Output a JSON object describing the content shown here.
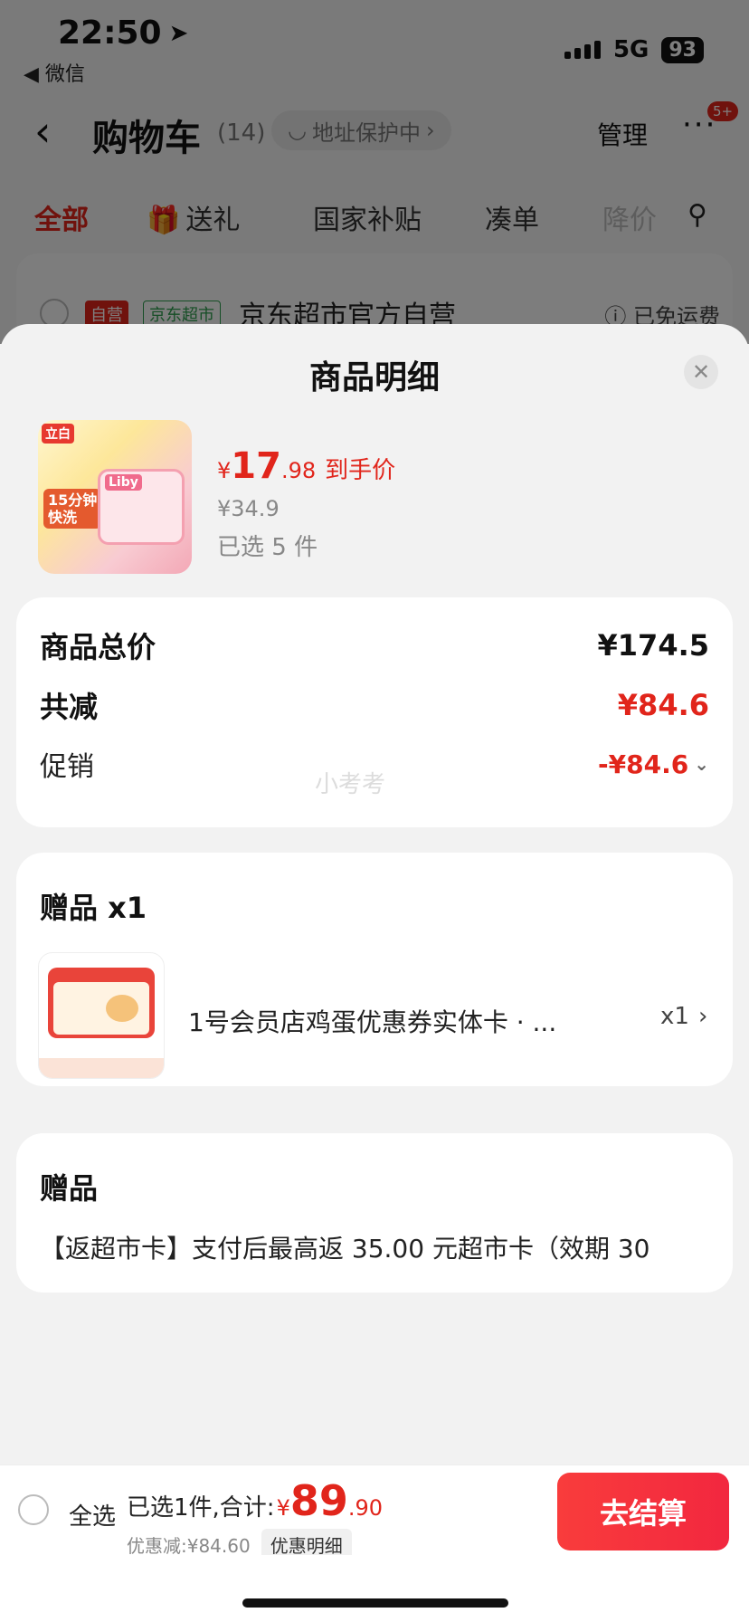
{
  "status_bar": {
    "time": "22:50",
    "back_app": "◀ 微信",
    "network": "5G",
    "battery": "93"
  },
  "nav": {
    "title": "购物车",
    "count": "(14)",
    "address_protect": "地址保护中",
    "manage": "管理",
    "more_badge": "5+"
  },
  "tabs": [
    {
      "label": "全部"
    },
    {
      "label": "送礼"
    },
    {
      "label": "国家补贴"
    },
    {
      "label": "凑单"
    },
    {
      "label": "降价"
    }
  ],
  "store": {
    "self_tag": "自营",
    "channel_tag": "京东超市",
    "name": "京东超市官方自营",
    "shipping": "已免运费"
  },
  "sheet": {
    "title": "商品明细",
    "product": {
      "brand_label": "立白",
      "sticker_text": "15分钟\n快洗",
      "pack_brand": "Liby",
      "price_currency": "¥",
      "price_int": "17",
      "price_dec": ".98",
      "price_label": "到手价",
      "original_price": "¥34.9",
      "selected_count": "已选 5 件"
    },
    "price_card": {
      "total_label": "商品总价",
      "total_value": "¥174.5",
      "reduce_label": "共减",
      "reduce_value": "¥84.6",
      "promo_label": "促销",
      "promo_value": "-¥84.6",
      "watermark": "小考考"
    },
    "gift_card": {
      "title": "赠品 x1",
      "item_name": "1号会员店鸡蛋优惠券实体卡 · ...",
      "item_qty": "x1"
    },
    "gift_card2": {
      "title": "赠品",
      "text": "【返超市卡】支付后最高返 35.00 元超市卡（效期 30"
    }
  },
  "bottom_bar": {
    "select_all": "全选",
    "summary_prefix": "已选1件,合计:",
    "total_currency": "¥",
    "total_int": "89",
    "total_dec": ".90",
    "discount_text": "优惠减:¥84.60",
    "discount_detail": "优惠明细",
    "checkout": "去结算"
  },
  "colors": {
    "accent_red": "#e1251b",
    "checkout_red": "#f93c3c"
  }
}
